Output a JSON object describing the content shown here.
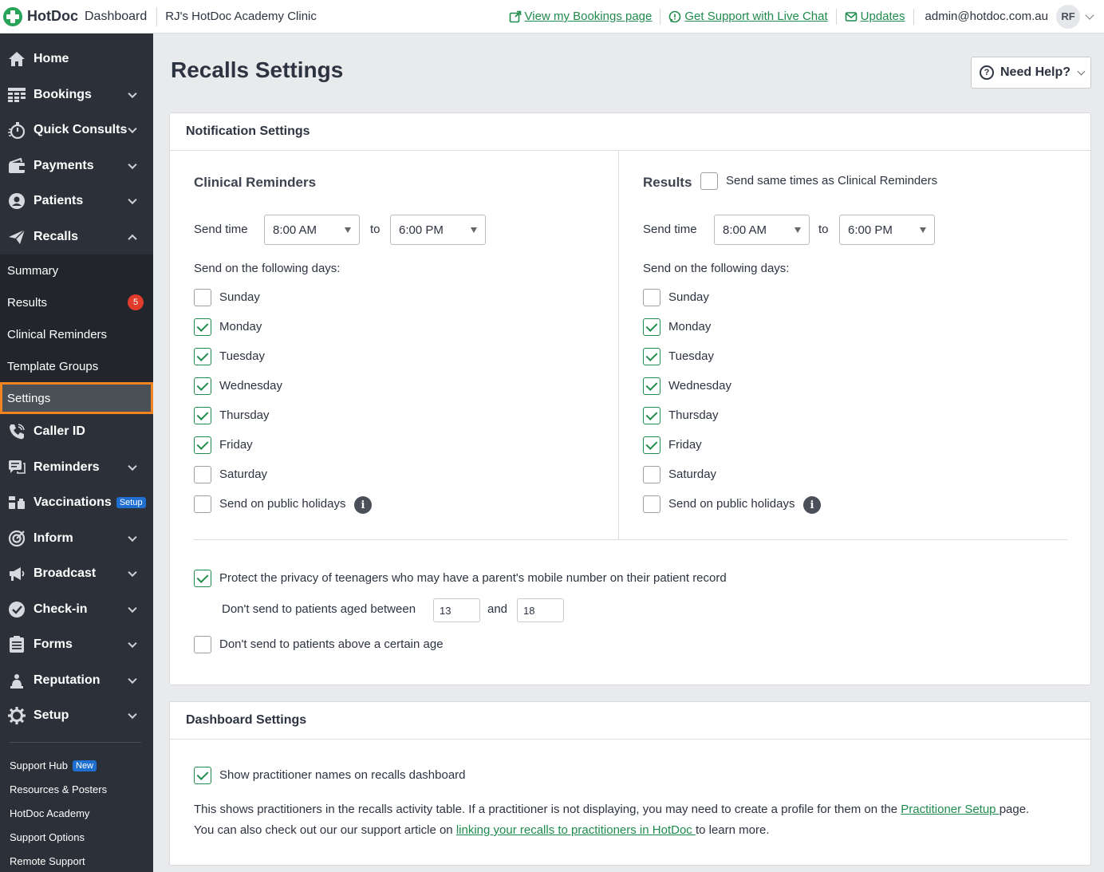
{
  "app": {
    "logo_text": "HotDoc",
    "logo_sub": "Dashboard",
    "clinic": "RJ's HotDoc Academy Clinic"
  },
  "topbar": {
    "links": [
      {
        "label": "View my Bookings page",
        "icon": "external-link-icon"
      },
      {
        "label": "Get Support with Live Chat",
        "icon": "chat-icon"
      },
      {
        "label": "Updates",
        "icon": "mail-icon"
      }
    ],
    "user_email": "admin@hotdoc.com.au",
    "avatar_initials": "RF"
  },
  "sidebar": {
    "items": [
      {
        "label": "Home",
        "icon": "home-icon"
      },
      {
        "label": "Bookings",
        "icon": "bookings-icon"
      },
      {
        "label": "Quick Consults",
        "icon": "stopwatch-icon"
      },
      {
        "label": "Payments",
        "icon": "wallet-icon"
      },
      {
        "label": "Patients",
        "icon": "user-circle-icon"
      },
      {
        "label": "Recalls",
        "icon": "paper-plane-icon"
      }
    ],
    "recalls_sub": [
      {
        "label": "Summary"
      },
      {
        "label": "Results",
        "badge": "5"
      },
      {
        "label": "Clinical Reminders"
      },
      {
        "label": "Template Groups"
      },
      {
        "label": "Settings"
      }
    ],
    "items_after": [
      {
        "label": "Caller ID",
        "icon": "phone-icon"
      },
      {
        "label": "Reminders",
        "icon": "message-icon"
      },
      {
        "label": "Vaccinations",
        "icon": "vaccine-icon",
        "pill": "Setup"
      },
      {
        "label": "Inform",
        "icon": "target-icon"
      },
      {
        "label": "Broadcast",
        "icon": "megaphone-icon"
      },
      {
        "label": "Check-in",
        "icon": "check-circle-icon"
      },
      {
        "label": "Forms",
        "icon": "clipboard-icon"
      },
      {
        "label": "Reputation",
        "icon": "person-star-icon"
      },
      {
        "label": "Setup",
        "icon": "gear-icon"
      }
    ],
    "footer": [
      {
        "label": "Support Hub",
        "pill": "New"
      },
      {
        "label": "Resources & Posters"
      },
      {
        "label": "HotDoc Academy"
      },
      {
        "label": "Support Options"
      },
      {
        "label": "Remote Support"
      }
    ]
  },
  "page": {
    "title": "Recalls Settings",
    "help_label": "Need Help?"
  },
  "notification": {
    "header": "Notification Settings",
    "clinical": {
      "title": "Clinical Reminders",
      "send_time_label": "Send time",
      "from": "8:00 AM",
      "to_label": "to",
      "to": "6:00 PM",
      "days_label": "Send on the following days:",
      "days": [
        {
          "label": "Sunday",
          "checked": false
        },
        {
          "label": "Monday",
          "checked": true
        },
        {
          "label": "Tuesday",
          "checked": true
        },
        {
          "label": "Wednesday",
          "checked": true
        },
        {
          "label": "Thursday",
          "checked": true
        },
        {
          "label": "Friday",
          "checked": true
        },
        {
          "label": "Saturday",
          "checked": false
        }
      ],
      "holidays_label": "Send on public holidays"
    },
    "results": {
      "title": "Results",
      "same_times_label": "Send same times as Clinical Reminders",
      "send_time_label": "Send time",
      "from": "8:00 AM",
      "to_label": "to",
      "to": "6:00 PM",
      "days_label": "Send on the following days:",
      "days": [
        {
          "label": "Sunday",
          "checked": false
        },
        {
          "label": "Monday",
          "checked": true
        },
        {
          "label": "Tuesday",
          "checked": true
        },
        {
          "label": "Wednesday",
          "checked": true
        },
        {
          "label": "Thursday",
          "checked": true
        },
        {
          "label": "Friday",
          "checked": true
        },
        {
          "label": "Saturday",
          "checked": false
        }
      ],
      "holidays_label": "Send on public holidays"
    },
    "privacy_label": "Protect the privacy of teenagers who may have a parent's mobile number on their patient record",
    "age_between_label": "Don't send to patients aged between",
    "age_min": "13",
    "and_label": "and",
    "age_max": "18",
    "above_age_label": "Don't send to patients above a certain age"
  },
  "dashboard": {
    "header": "Dashboard Settings",
    "show_names_label": "Show practitioner names on recalls dashboard",
    "desc1_pre": "This shows practitioners in the recalls activity table. If a practitioner is not displaying, you may need to create a profile for them on the ",
    "desc1_link": "Practitioner Setup ",
    "desc1_post": "page.",
    "desc2_pre": "You can also check out our our support article on ",
    "desc2_link": "linking your recalls to practitioners in HotDoc ",
    "desc2_post": "to learn more."
  }
}
